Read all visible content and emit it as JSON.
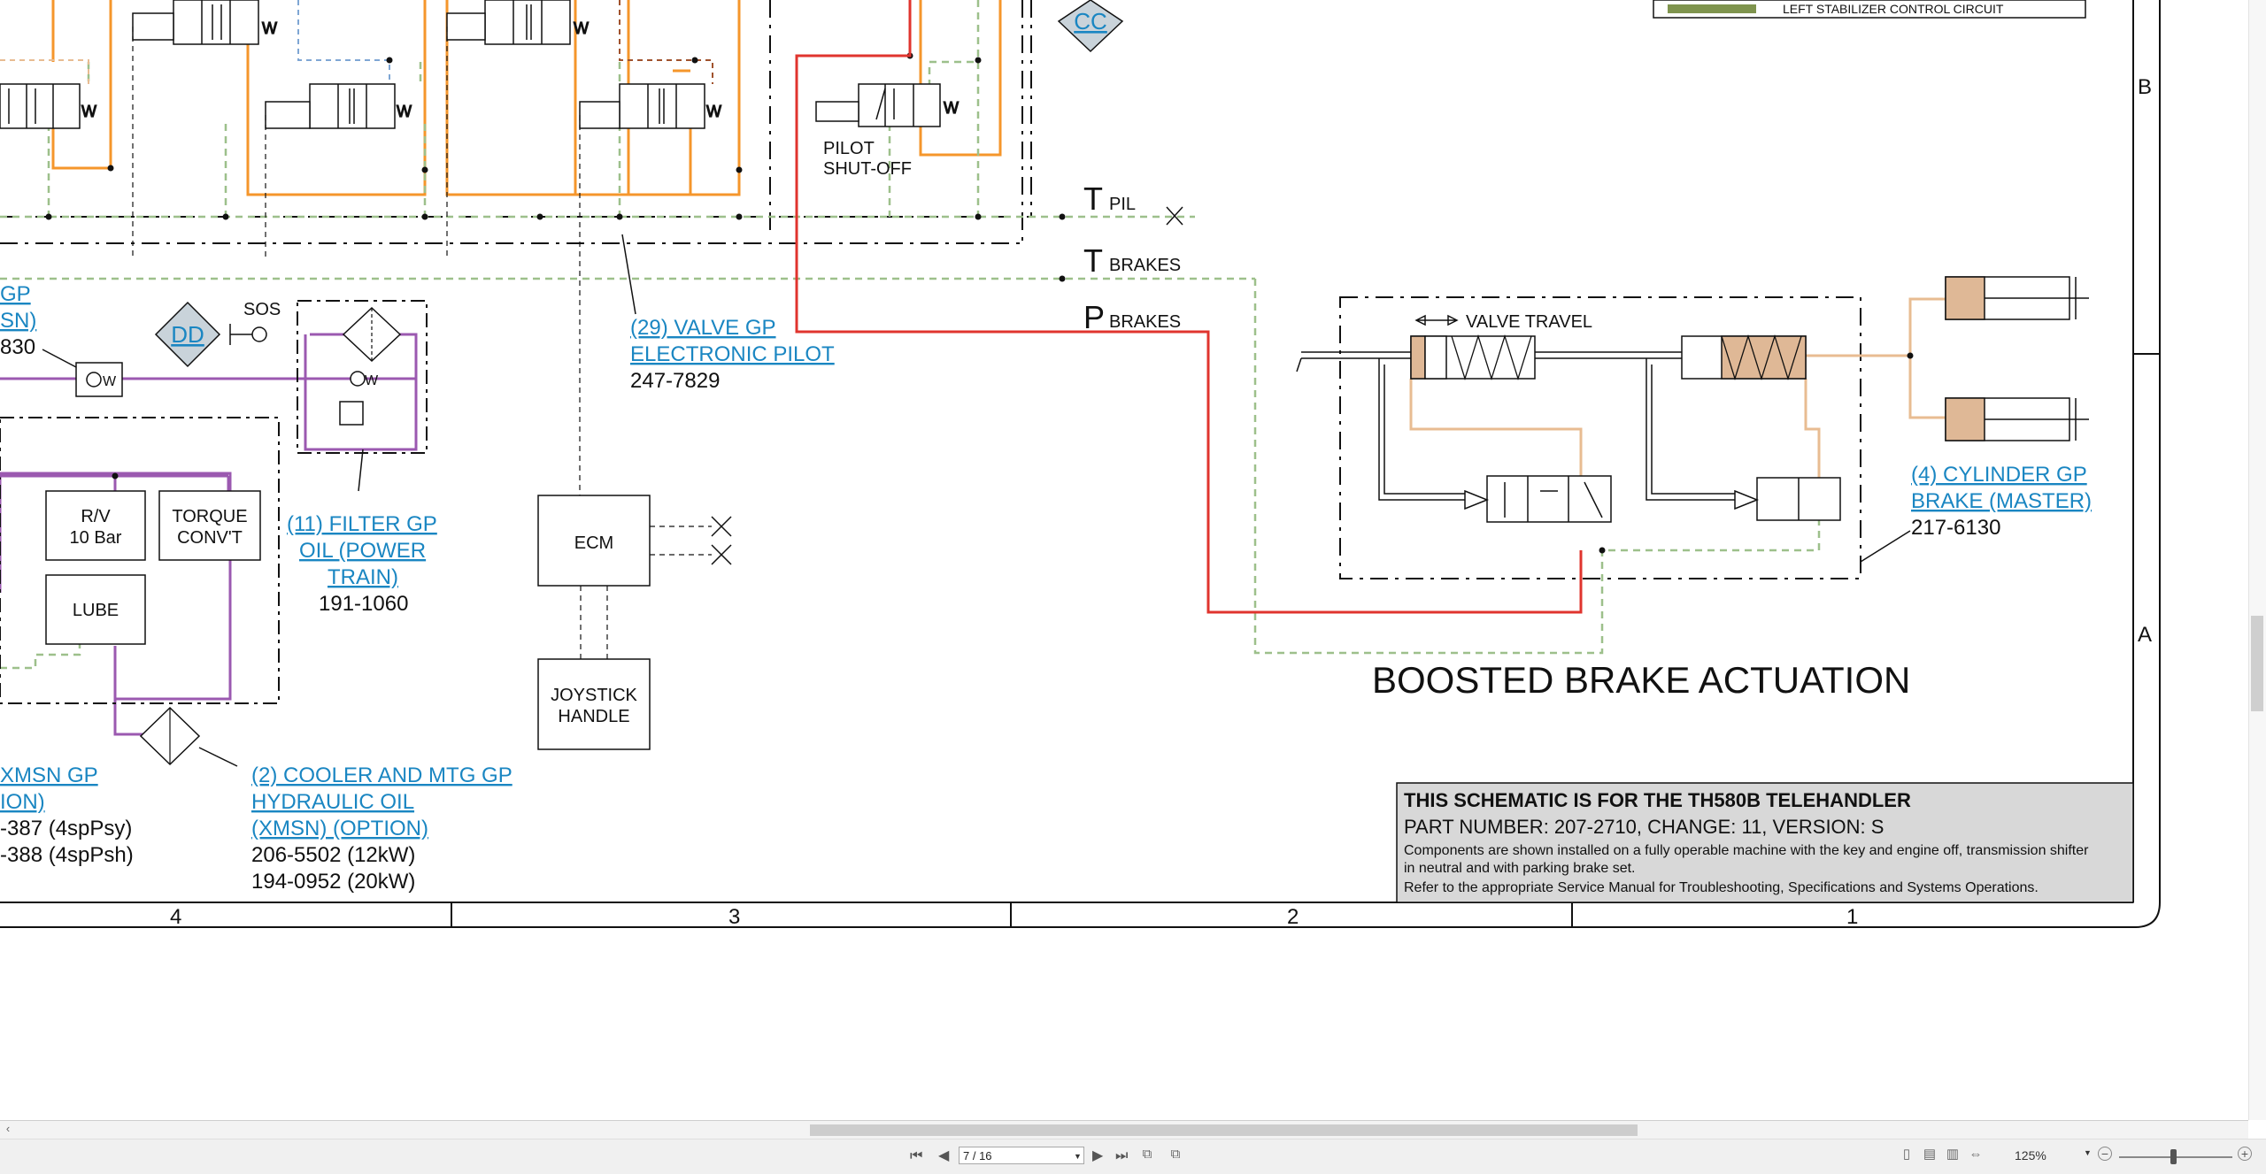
{
  "document": {
    "legend": {
      "item": "LEFT STABILIZER CONTROL CIRCUIT",
      "color": "#7f944e"
    },
    "zone_markers": [
      "B",
      "A"
    ],
    "column_numbers": [
      "4",
      "3",
      "2",
      "1"
    ],
    "badges": {
      "cc": "CC",
      "dd": "DD",
      "sos": "SOS"
    },
    "lines": {
      "t_pil": "T",
      "t_pil_sub": "PIL",
      "t_brakes": "T",
      "t_brakes_sub": "BRAKES",
      "p_brakes": "P",
      "p_brakes_sub": "BRAKES"
    },
    "labels": {
      "pilot": [
        "PILOT",
        "SHUT-OFF"
      ],
      "valve_travel": "VALVE TRAVEL",
      "ecm": "ECM",
      "joystick": [
        "JOYSTICK",
        "HANDLE"
      ],
      "rv": [
        "R/V",
        "10 Bar"
      ],
      "torque": [
        "TORQUE",
        "CONV'T"
      ],
      "lube": "LUBE",
      "section_title": "BOOSTED BRAKE ACTUATION"
    },
    "links": {
      "left_partial": [
        "GP",
        "SN)"
      ],
      "left_partial_num": "830",
      "valve29": [
        "(29) VALVE GP",
        "ELECTRONIC PILOT"
      ],
      "valve29_num": "247-7829",
      "filter11": [
        "(11) FILTER GP",
        "OIL (POWER",
        "TRAIN)"
      ],
      "filter11_num": "191-1060",
      "cooler2": [
        "(2) COOLER AND MTG GP",
        "HYDRAULIC OIL",
        "(XMSN) (OPTION)"
      ],
      "cooler2_nums": [
        "206-5502 (12kW)",
        "194-0952 (20kW)"
      ],
      "xmsn": [
        "XMSN GP",
        "ION)"
      ],
      "xmsn_nums": [
        "-387 (4spPsy)",
        "-388 (4spPsh)"
      ],
      "cylinder4": [
        "(4) CYLINDER GP",
        "BRAKE (MASTER)"
      ],
      "cylinder4_num": "217-6130"
    },
    "titleblock": {
      "line1": "THIS SCHEMATIC IS FOR THE TH580B TELEHANDLER",
      "line2": "PART NUMBER: 207-2710, CHANGE: 11, VERSION: S",
      "line3": "Components are shown installed on a fully operable machine with the key and engine off, transmission shifter",
      "line4": "in neutral and with parking brake set.",
      "line5": "Refer to the appropriate Service Manual for Troubleshooting, Specifications and Systems Operations."
    },
    "colors": {
      "orange": "#f5962b",
      "red": "#e0342e",
      "purple": "#9b59b0",
      "green_dash": "#9dc08b",
      "tan": "#e8bc92",
      "blue_dash": "#7ea6d4",
      "brown_dash": "#a0522d",
      "link": "#1a86c2"
    }
  },
  "viewer": {
    "page_indicator": "7 / 16",
    "zoom": "125%",
    "nav": {
      "first": "⏮",
      "prev": "◀",
      "next": "▶",
      "last": "⏭"
    },
    "zoom_out": "−",
    "zoom_in": "+"
  }
}
